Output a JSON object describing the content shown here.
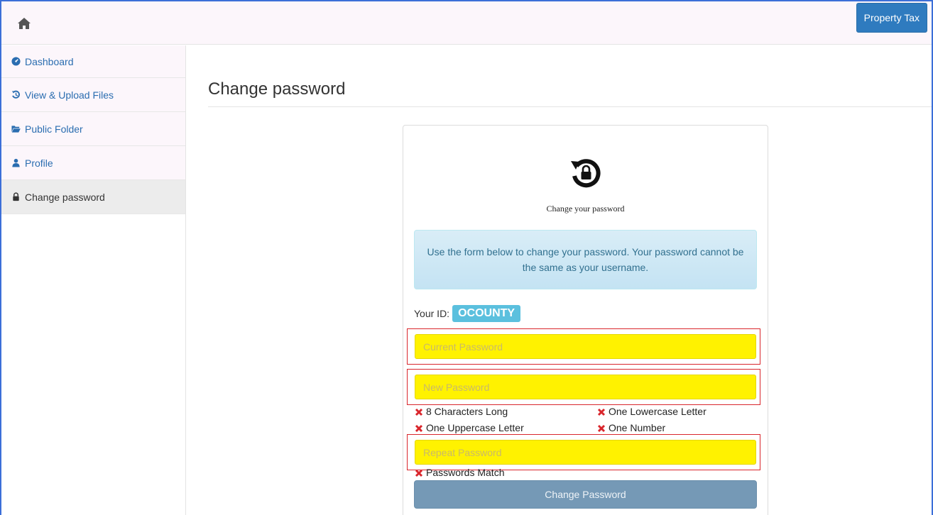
{
  "header": {
    "home_icon": "home-icon",
    "property_tax_label": "Property Tax"
  },
  "sidebar": {
    "items": [
      {
        "label": "Dashboard",
        "icon": "dashboard-icon"
      },
      {
        "label": "View & Upload Files",
        "icon": "history-icon"
      },
      {
        "label": "Public Folder",
        "icon": "folder-open-icon"
      },
      {
        "label": "Profile",
        "icon": "user-icon"
      },
      {
        "label": "Change password",
        "icon": "lock-icon",
        "active": true
      }
    ]
  },
  "main": {
    "page_title": "Change password",
    "card": {
      "icon": "password-reset-icon",
      "subtitle": "Change your password",
      "info_text": "Use the form below to change your password. Your password cannot be the same as your username.",
      "id_label": "Your ID:",
      "id_value": "OCOUNTY",
      "current_password_placeholder": "Current Password",
      "new_password_placeholder": "New Password",
      "repeat_password_placeholder": "Repeat Password",
      "rules": {
        "length": "8 Characters Long",
        "lowercase": "One Lowercase Letter",
        "uppercase": "One Uppercase Letter",
        "number": "One Number",
        "match": "Passwords Match"
      },
      "submit_label": "Change Password"
    }
  },
  "colors": {
    "accent": "#2f7bbf",
    "highlight_field": "#fff200",
    "invalid": "#d9262c",
    "info_bg": "#d9edf7",
    "id_badge": "#5bc0de",
    "submit_bg": "#7599b6"
  }
}
